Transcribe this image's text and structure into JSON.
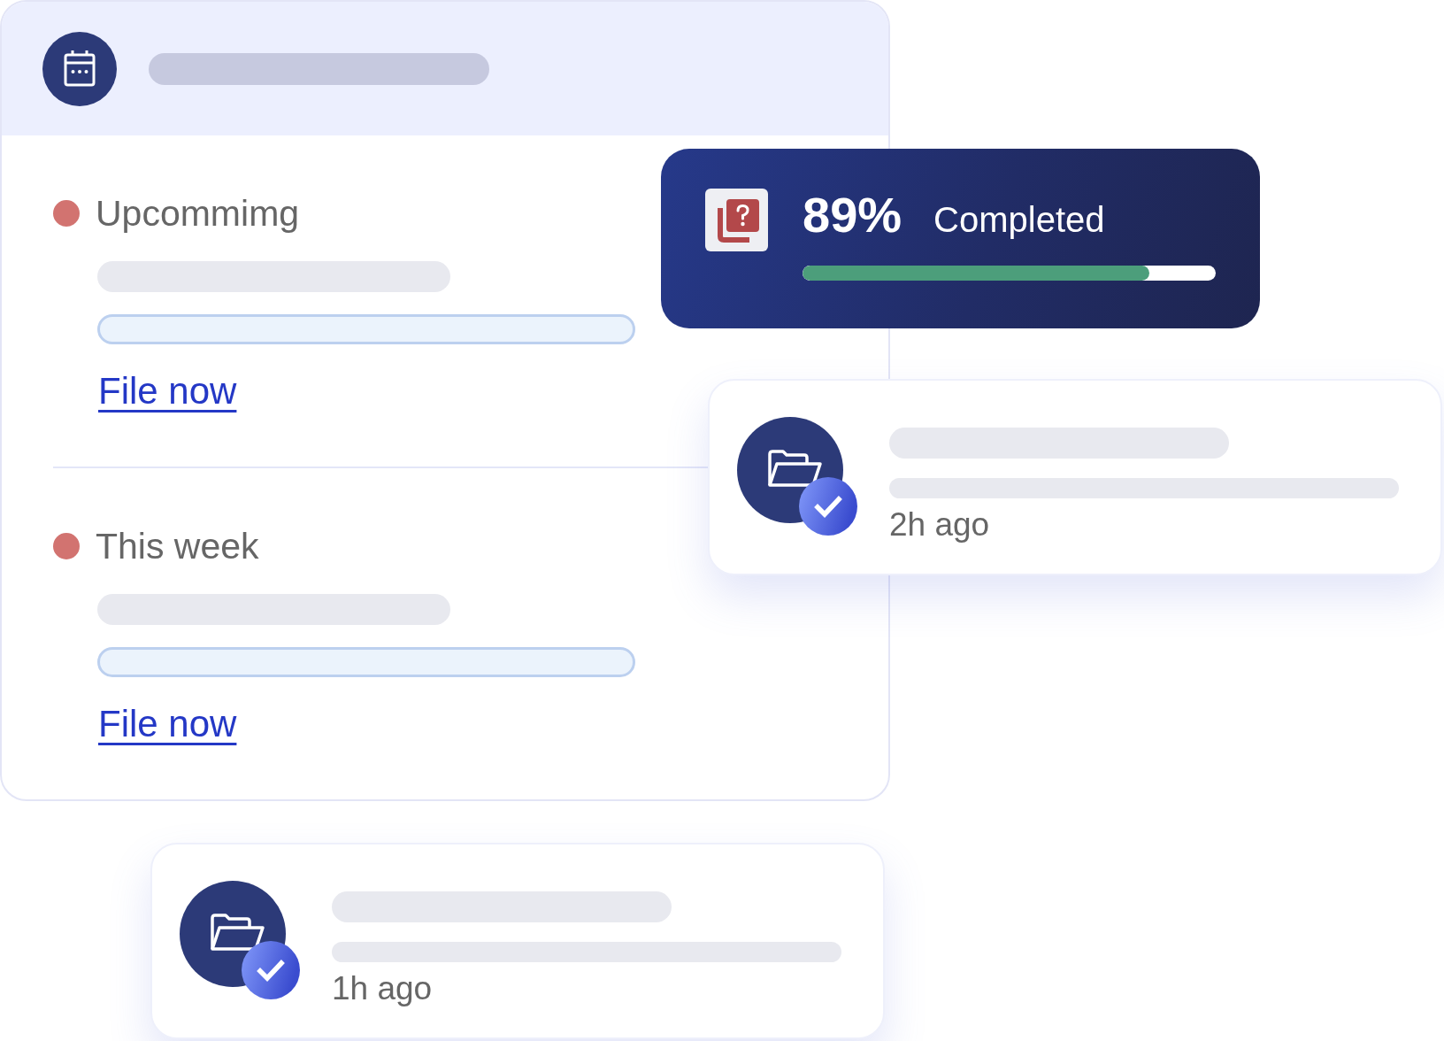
{
  "sections": [
    {
      "label": "Upcommimg",
      "color": "#d27370",
      "link": "File now"
    },
    {
      "label": "This week",
      "color": "#d27370",
      "link": "File now"
    }
  ],
  "progress": {
    "percent": "89%",
    "label": "Completed",
    "level": 0.84
  },
  "activity": [
    {
      "time": "2h ago"
    },
    {
      "time": "1h ago"
    }
  ]
}
